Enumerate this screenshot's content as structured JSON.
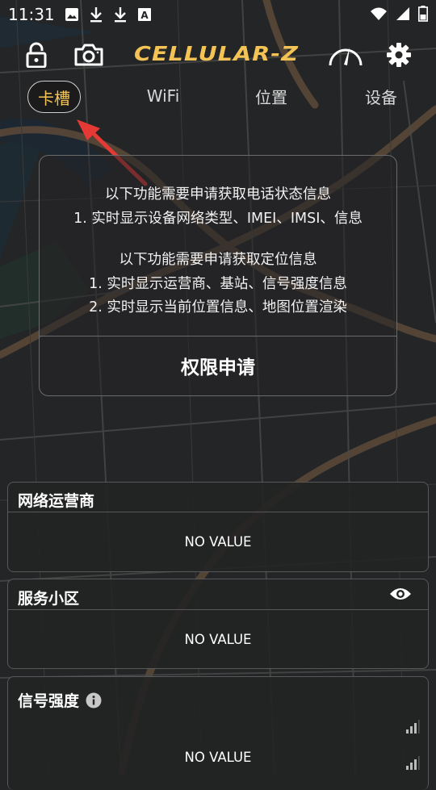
{
  "status_bar": {
    "time": "11:31",
    "icons": [
      "image-icon",
      "download-icon",
      "download-icon",
      "font-a-icon"
    ],
    "right_icons": [
      "wifi-icon",
      "signal-icon",
      "battery-icon"
    ]
  },
  "header": {
    "logo_text": "CELLULAR-Z",
    "accent_color": "#f3c355",
    "buttons": [
      "lock-open-icon",
      "camera-icon",
      "speedometer-icon",
      "gear-icon"
    ]
  },
  "tabs": [
    {
      "label": "卡槽",
      "active": true
    },
    {
      "label": "WiFi",
      "active": false
    },
    {
      "label": "位置",
      "active": false
    },
    {
      "label": "设备",
      "active": false
    }
  ],
  "permission_card": {
    "lines": [
      "以下功能需要申请获取电话状态信息",
      "1. 实时显示设备网络类型、IMEI、IMSI、信息",
      "",
      "以下功能需要申请获取定位信息",
      "1. 实时显示运营商、基站、信号强度信息",
      "2. 实时显示当前位置信息、地图位置渲染"
    ],
    "button_label": "权限申请"
  },
  "annotation_arrow_color": "#e53935",
  "info_cards": [
    {
      "title": "网络运营商",
      "value": "NO VALUE"
    },
    {
      "title": "服务小区",
      "value": "NO VALUE",
      "icon": "eye-icon"
    },
    {
      "title": "信号强度",
      "value": "NO VALUE",
      "icon": "info-icon"
    }
  ]
}
